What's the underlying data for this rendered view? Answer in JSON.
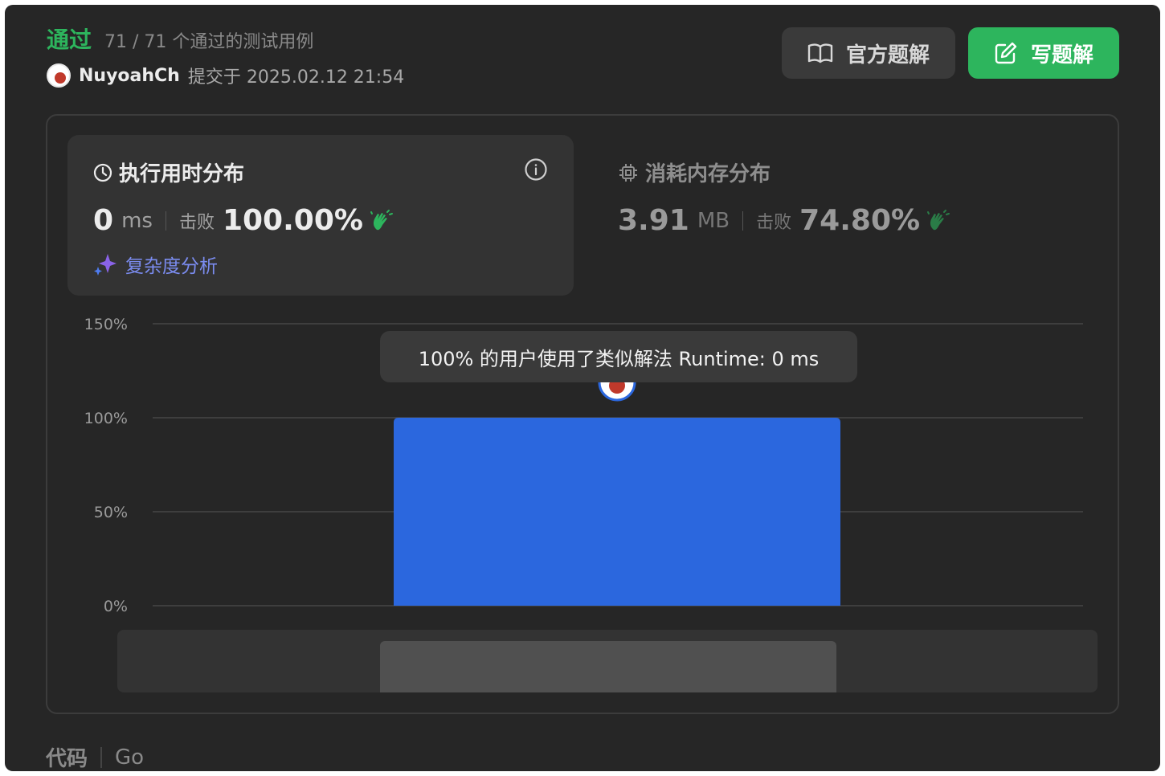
{
  "header": {
    "status": "通过",
    "testcases": "71 / 71 个通过的测试用例",
    "username": "NuyoahCh",
    "submitted_text": "提交于 2025.02.12 21:54",
    "official_solution_label": "官方题解",
    "write_solution_label": "写题解"
  },
  "runtime": {
    "title": "执行用时分布",
    "value": "0",
    "unit": "ms",
    "beat_label": "击败",
    "beat_pct": "100.00%",
    "complexity_label": "复杂度分析"
  },
  "memory": {
    "title": "消耗内存分布",
    "value": "3.91",
    "unit": "MB",
    "beat_label": "击败",
    "beat_pct": "74.80%"
  },
  "chart_data": {
    "type": "bar",
    "title": "",
    "xlabel": "",
    "ylabel": "",
    "categories": [
      "0 ms"
    ],
    "values": [
      100
    ],
    "y_ticks": [
      "150%",
      "100%",
      "50%",
      "0%"
    ],
    "ylim": [
      0,
      150
    ],
    "grid": true,
    "tooltip": "100% 的用户使用了类似解法 Runtime: 0 ms",
    "bar_color": "#2b67de"
  },
  "footer": {
    "code_label": "代码",
    "language": "Go"
  },
  "colors": {
    "pass_green": "#2db55d",
    "accent_purple": "#7b8cf0"
  }
}
